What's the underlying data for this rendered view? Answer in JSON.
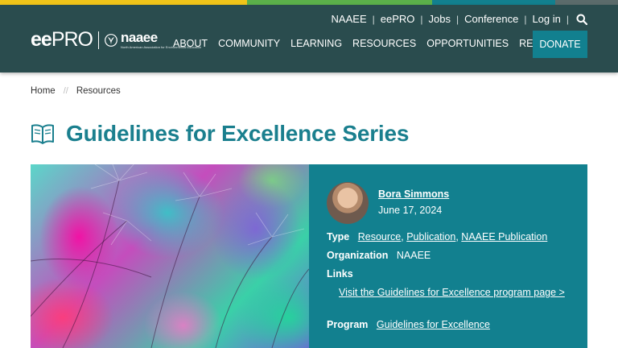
{
  "colors": {
    "header_bg": "#2a4c4e",
    "accent": "#12808f",
    "title": "#1a7f8e",
    "strip": [
      "#f0c419",
      "#5bb04a",
      "#12808f",
      "#5b6b6b"
    ]
  },
  "utility_nav": {
    "items": [
      "NAAEE",
      "eePRO",
      "Jobs",
      "Conference",
      "Log in"
    ],
    "search_icon": "search-icon"
  },
  "logo": {
    "ee": "ee",
    "pro": "PRO",
    "naaee": "naaee",
    "naaee_sub": "North American Association for Environmental Education"
  },
  "main_nav": {
    "items": [
      "ABOUT",
      "COMMUNITY",
      "LEARNING",
      "RESOURCES",
      "OPPORTUNITIES",
      "RESEARCH"
    ],
    "donate": "DONATE"
  },
  "breadcrumb": {
    "home": "Home",
    "separator": "//",
    "current": "Resources"
  },
  "page": {
    "title": "Guidelines for Excellence Series",
    "title_icon": "book-icon"
  },
  "resource": {
    "author": "Bora Simmons",
    "date": "June 17, 2024",
    "type_label": "Type",
    "types": [
      "Resource",
      "Publication",
      "NAAEE Publication"
    ],
    "organization_label": "Organization",
    "organization": "NAAEE",
    "links_label": "Links",
    "link_text": "Visit the Guidelines for Excellence program page >",
    "program_label": "Program",
    "program": "Guidelines for Excellence"
  }
}
